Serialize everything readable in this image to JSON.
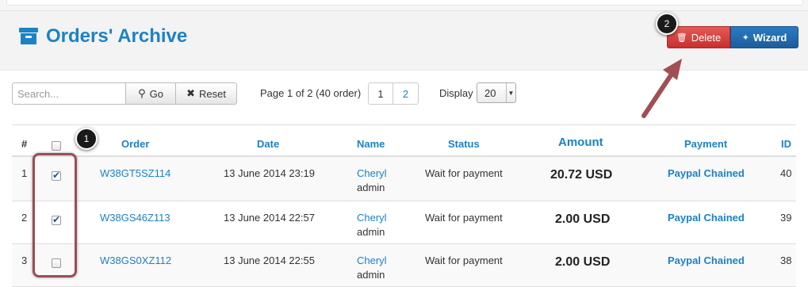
{
  "header": {
    "title": "Orders' Archive",
    "title_icon": "archive-icon",
    "delete_label": "Delete",
    "delete_icon": "trash-icon",
    "wizard_label": "Wizard",
    "wizard_icon": "magic-wand-icon"
  },
  "annotations": {
    "marker1": "1",
    "marker2": "2"
  },
  "toolbar": {
    "search_placeholder": "Search...",
    "go_label": "Go",
    "reset_label": "Reset",
    "page_info": "Page 1 of 2 (40 order)",
    "pages": [
      "1",
      "2"
    ],
    "display_label": "Display",
    "display_value": "20"
  },
  "table": {
    "headers": {
      "num": "#",
      "order": "Order",
      "date": "Date",
      "name": "Name",
      "status": "Status",
      "amount": "Amount",
      "payment": "Payment",
      "id": "ID"
    },
    "rows": [
      {
        "num": "1",
        "checked": true,
        "order": "W38GT5SZ114",
        "date": "13 June 2014 23:19",
        "name": "Cheryl",
        "role": "admin",
        "status": "Wait for payment",
        "amount": "20.72 USD",
        "payment": "Paypal Chained",
        "id": "40"
      },
      {
        "num": "2",
        "checked": true,
        "order": "W38GS46Z113",
        "date": "13 June 2014 22:57",
        "name": "Cheryl",
        "role": "admin",
        "status": "Wait for payment",
        "amount": "2.00 USD",
        "payment": "Paypal Chained",
        "id": "39"
      },
      {
        "num": "3",
        "checked": false,
        "order": "W38GS0XZ112",
        "date": "13 June 2014 22:55",
        "name": "Cheryl",
        "role": "admin",
        "status": "Wait for payment",
        "amount": "2.00 USD",
        "payment": "Paypal Chained",
        "id": "38"
      }
    ]
  },
  "colors": {
    "accent": "#1b82c5",
    "danger": "#d9534f",
    "primary": "#2a6ebb",
    "annotation": "#9b4e56"
  }
}
